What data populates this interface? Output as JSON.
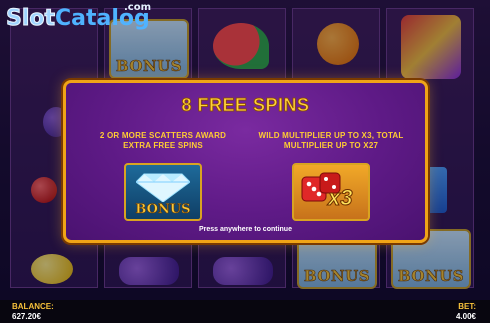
{
  "watermark": {
    "brand_part1": "Slot",
    "brand_part2": "Catalog",
    "domain": ".com"
  },
  "reels": {
    "bonus_symbols": [
      {
        "reel": 2,
        "row": 1,
        "label": "BONUS"
      },
      {
        "reel": 4,
        "row": 4,
        "label": "BONUS"
      },
      {
        "reel": 5,
        "row": 4,
        "label": "BONUS"
      }
    ],
    "visible_symbols": [
      "diamond",
      "watermelon",
      "orange",
      "jester",
      "plum",
      "cherry",
      "lemon",
      "grapes",
      "seven",
      "bonus"
    ]
  },
  "popup": {
    "title": "8 FREE SPINS",
    "left_feature": {
      "text_line1": "2 OR MORE SCATTERS AWARD",
      "text_line2": "EXTRA FREE SPINS",
      "icon_label": "BONUS",
      "icon": "diamond-icon"
    },
    "right_feature": {
      "text_line1": "WILD MULTIPLIER UP TO X3, TOTAL",
      "text_line2": "MULTIPLIER UP TO X27",
      "icon_label": "x3",
      "icon": "dice-icon"
    },
    "hint": "Press anywhere to continue"
  },
  "footer": {
    "balance_label": "BALANCE:",
    "balance_value": "627.20€",
    "bet_label": "BET:",
    "bet_value": "4.00€"
  },
  "colors": {
    "gold": "#f0a417",
    "popup_purple": "#5e1a86",
    "title_yellow": "#ffd23a",
    "label_yellow": "#f7c23a"
  }
}
